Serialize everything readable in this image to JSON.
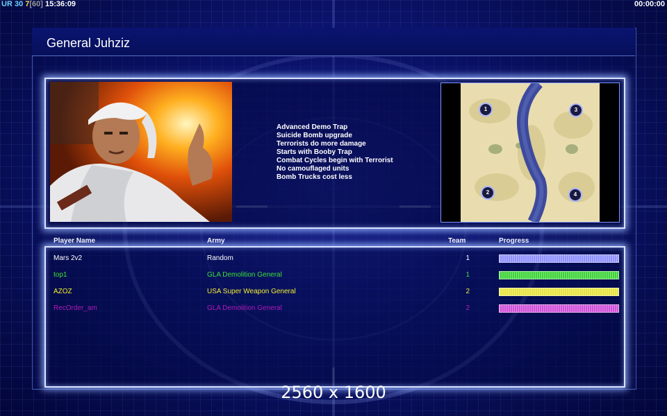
{
  "hud": {
    "ur": "UR",
    "fps": "30",
    "logic": "7",
    "logic_max": "[60]",
    "clock": "15:36:09",
    "game_timer": "00:00:00"
  },
  "title": "General Juhziz",
  "traits": [
    "Advanced Demo Trap",
    "Suicide Bomb upgrade",
    "Terrorists do more damage",
    "Starts with Booby Trap",
    "Combat Cycles begin with Terrorist",
    "No camouflaged units",
    "Bomb Trucks cost less"
  ],
  "minimap": {
    "start_positions": [
      "1",
      "2",
      "3",
      "4"
    ]
  },
  "columns": {
    "player": "Player Name",
    "army": "Army",
    "team": "Team",
    "progress": "Progress"
  },
  "players": [
    {
      "name": "Mars 2v2",
      "army": "Random",
      "team": "1",
      "color": "#ffffff",
      "bar_color": "#8f90ff",
      "progress": 1.0
    },
    {
      "name": "top1",
      "army": "GLA Demolition General",
      "team": "1",
      "color": "#39e03a",
      "bar_color": "#3fd43a",
      "progress": 1.0
    },
    {
      "name": "AZOZ",
      "army": "USA Super Weapon General",
      "team": "2",
      "color": "#f3ef2e",
      "bar_color": "#e8e440",
      "progress": 1.0
    },
    {
      "name": "RecOrder_am",
      "army": "GLA Demolition General",
      "team": "2",
      "color": "#b01ab8",
      "bar_color": "#d050d8",
      "progress": 1.0
    }
  ],
  "watermark": "2560 x 1600"
}
